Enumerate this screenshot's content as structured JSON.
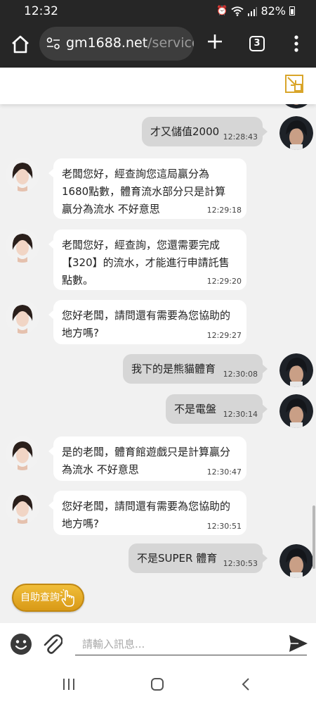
{
  "status_bar": {
    "time": "12:32",
    "battery": "82%",
    "icons": [
      "alarm-icon",
      "wifi-icon",
      "signal-icon",
      "battery-icon"
    ]
  },
  "browser": {
    "url_domain": "gm1688.net",
    "url_path": "/service/c",
    "tab_count": "3"
  },
  "messages": [
    {
      "sender": "user",
      "text": "才又儲值2000",
      "time": "12:28:43"
    },
    {
      "sender": "agent",
      "lines": [
        "老闆您好，經查詢您這局贏分為",
        "1680點數，體育流水部分只是計算",
        "贏分為流水 不好意思"
      ],
      "time": "12:29:18"
    },
    {
      "sender": "agent",
      "lines": [
        "老闆您好，經查詢，您還需要完成",
        "【320】的流水，才能進行申請託售",
        "點數。"
      ],
      "time": "12:29:20"
    },
    {
      "sender": "agent",
      "lines": [
        "您好老闆，請問還有需要為您協助的",
        "地方嗎?"
      ],
      "time": "12:29:27"
    },
    {
      "sender": "user",
      "text": "我下的是熊貓體育",
      "time": "12:30:08"
    },
    {
      "sender": "user",
      "text": "不是電盤",
      "time": "12:30:14"
    },
    {
      "sender": "agent",
      "lines": [
        "是的老闆，體育館遊戲只是計算贏分",
        "為流水 不好意思"
      ],
      "time": "12:30:47"
    },
    {
      "sender": "agent",
      "lines": [
        "您好老闆，請問還有需要為您協助的",
        "地方嗎?"
      ],
      "time": "12:30:51"
    },
    {
      "sender": "user",
      "text": "不是SUPER 體育",
      "time": "12:30:53"
    }
  ],
  "self_help_button": "自助查詢",
  "input": {
    "placeholder": "請輸入訊息...",
    "value": ""
  },
  "colors": {
    "browser_bar": "#262626",
    "chat_background": "#f1f1f1",
    "user_bubble": "#d6d6d6",
    "agent_bubble": "#ffffff",
    "accent_gold": "#e3a824"
  }
}
